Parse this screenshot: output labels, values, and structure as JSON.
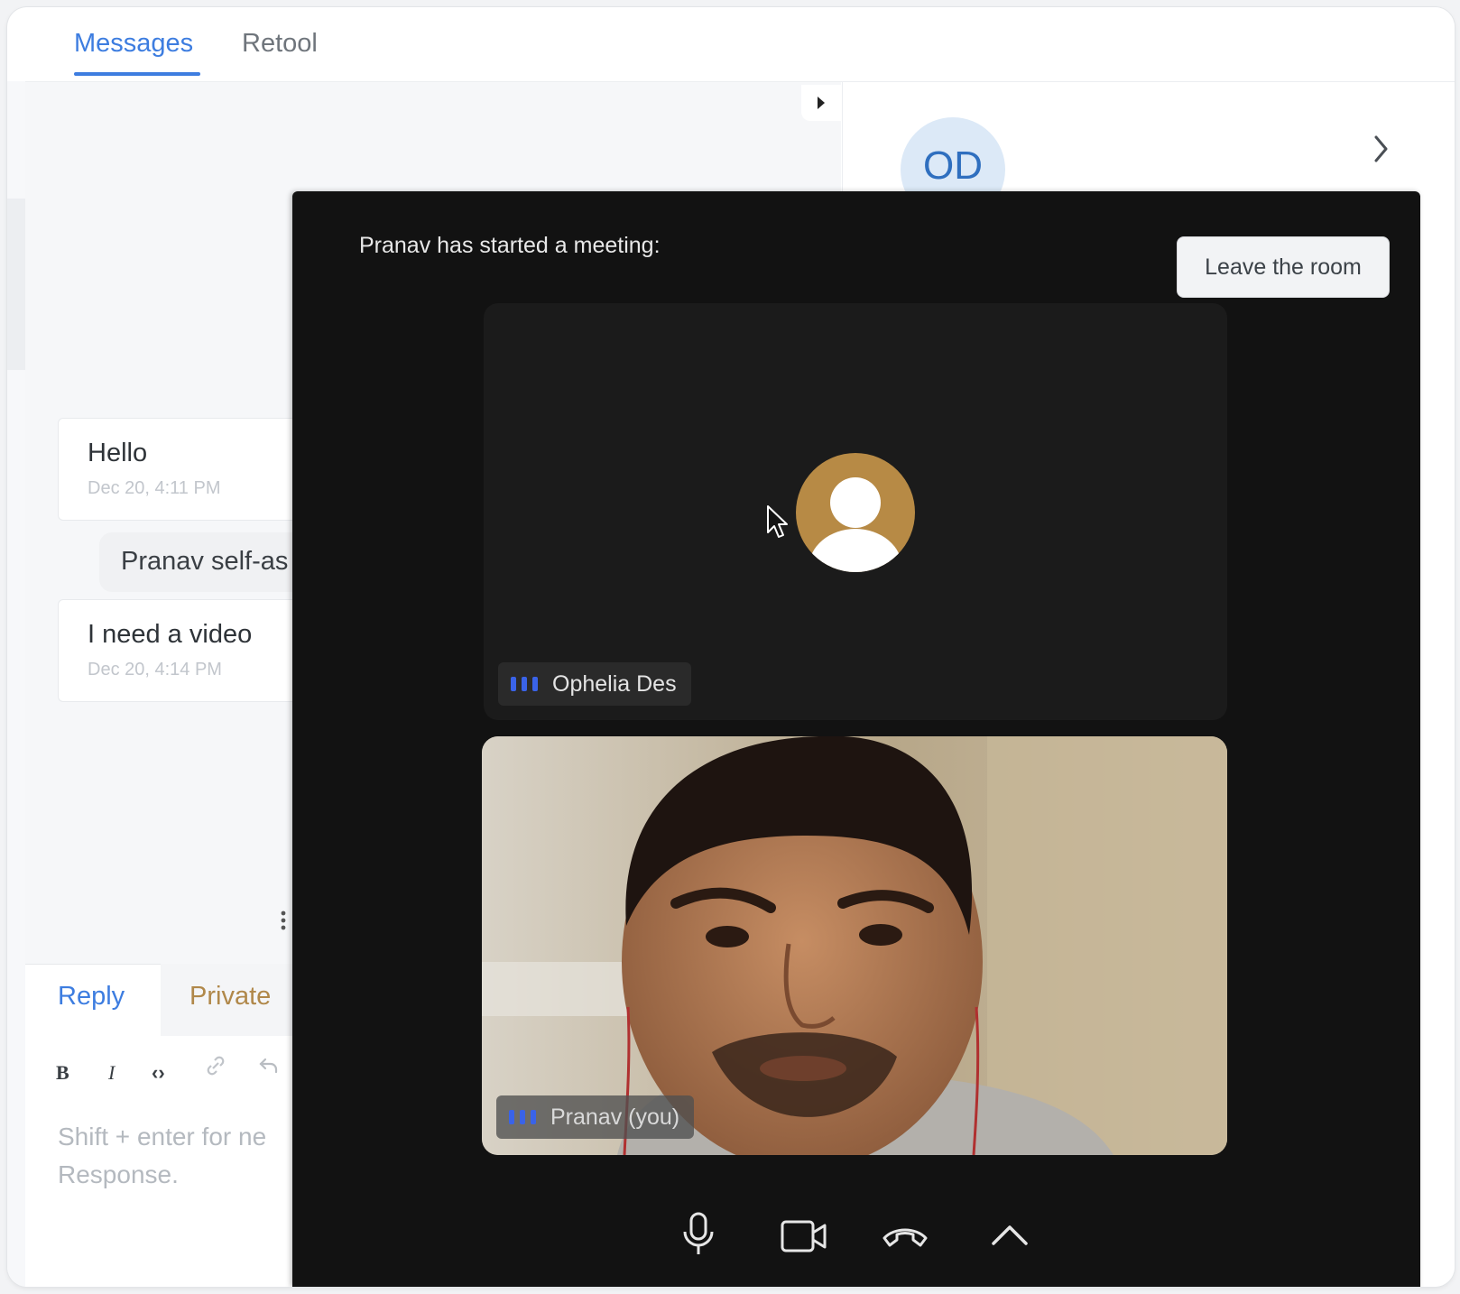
{
  "tabs": [
    {
      "label": "Messages",
      "active": true
    },
    {
      "label": "Retool",
      "active": false
    }
  ],
  "contact": {
    "initials": "OD"
  },
  "messages": [
    {
      "text": "Hello",
      "time": "Dec 20, 4:11 PM"
    },
    {
      "text": "I need a video",
      "time": "Dec 20, 4:14 PM"
    }
  ],
  "activity": {
    "text": "Pranav self-as"
  },
  "reply": {
    "tabs": [
      "Reply",
      "Private"
    ],
    "toolbar": {
      "bold": "B",
      "italic": "I",
      "code": "‹›"
    },
    "placeholder_line1": "Shift + enter for ne",
    "placeholder_line2": "Response."
  },
  "meeting": {
    "title": "Pranav has started a meeting:",
    "leave_label": "Leave the room",
    "participants": [
      {
        "name": "Ophelia Des",
        "video": false
      },
      {
        "name": "Pranav (you)",
        "video": true
      }
    ],
    "controls": [
      "microphone-icon",
      "camera-icon",
      "hang-up-icon",
      "chevron-up-icon"
    ]
  },
  "colors": {
    "accent": "#3d7de0",
    "private_tab": "#b0884a",
    "meeting_bg": "#121212",
    "speaking_bars": "#3a63e8",
    "avatar_bg": "#b78a45"
  }
}
